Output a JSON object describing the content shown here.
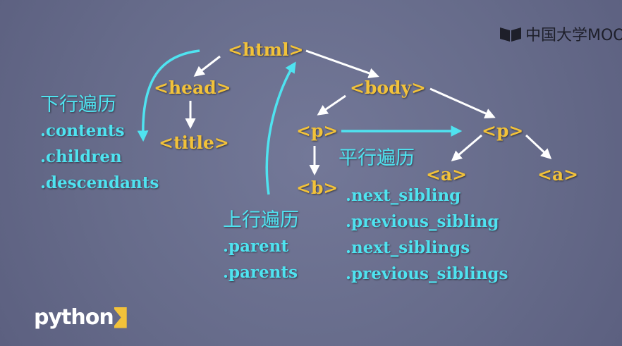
{
  "logos": {
    "mooc_text": "中国大学MOOC",
    "python_text": "python"
  },
  "nodes": {
    "html": "<html>",
    "head": "<head>",
    "body": "<body>",
    "title": "<title>",
    "p1": "<p>",
    "p2": "<p>",
    "b": "<b>",
    "a1": "<a>",
    "a2": "<a>"
  },
  "down_traversal": {
    "title": "下行遍历",
    "methods": [
      ".contents",
      ".children",
      ".descendants"
    ]
  },
  "up_traversal": {
    "title": "上行遍历",
    "methods": [
      ".parent",
      ".parents"
    ]
  },
  "sibling_traversal": {
    "title": "平行遍历",
    "methods": [
      ".next_sibling",
      ".previous_sibling",
      ".next_siblings",
      ".previous_siblings"
    ]
  },
  "colors": {
    "background": "#6a6f8e",
    "tag": "#f2c23a",
    "cyan": "#4fe3f0",
    "arrow_white": "#ffffff"
  }
}
